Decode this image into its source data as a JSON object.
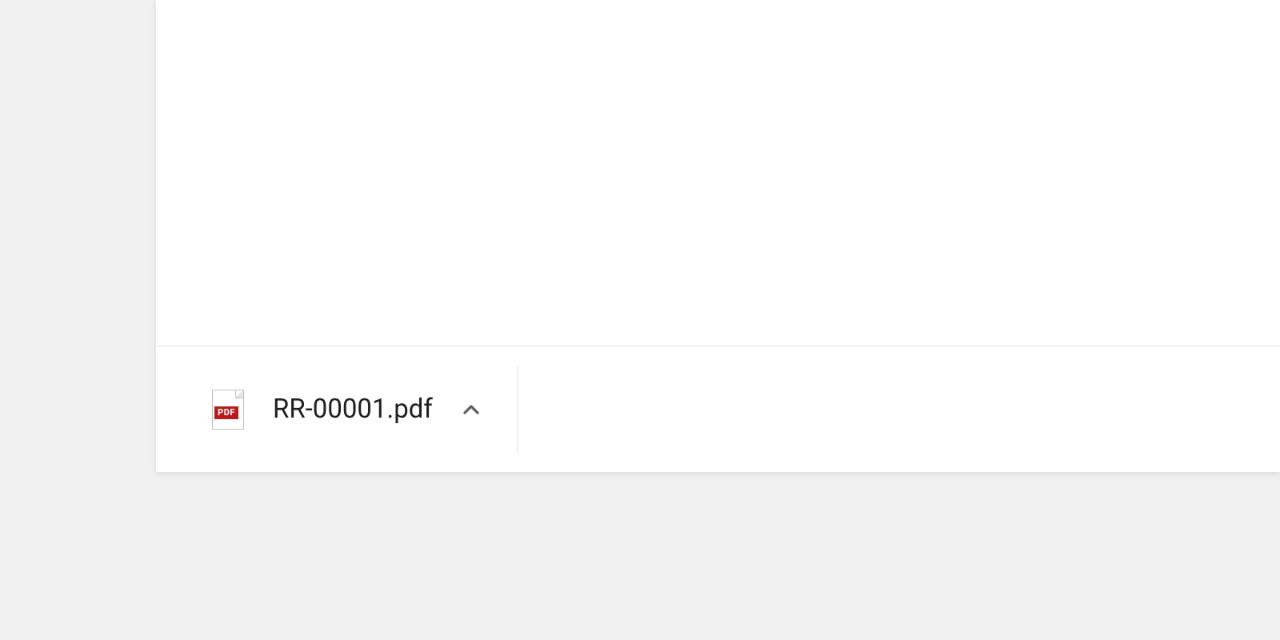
{
  "downloads": {
    "items": [
      {
        "filename": "RR-00001.pdf",
        "icon_type": "pdf",
        "icon_label": "PDF"
      }
    ]
  }
}
